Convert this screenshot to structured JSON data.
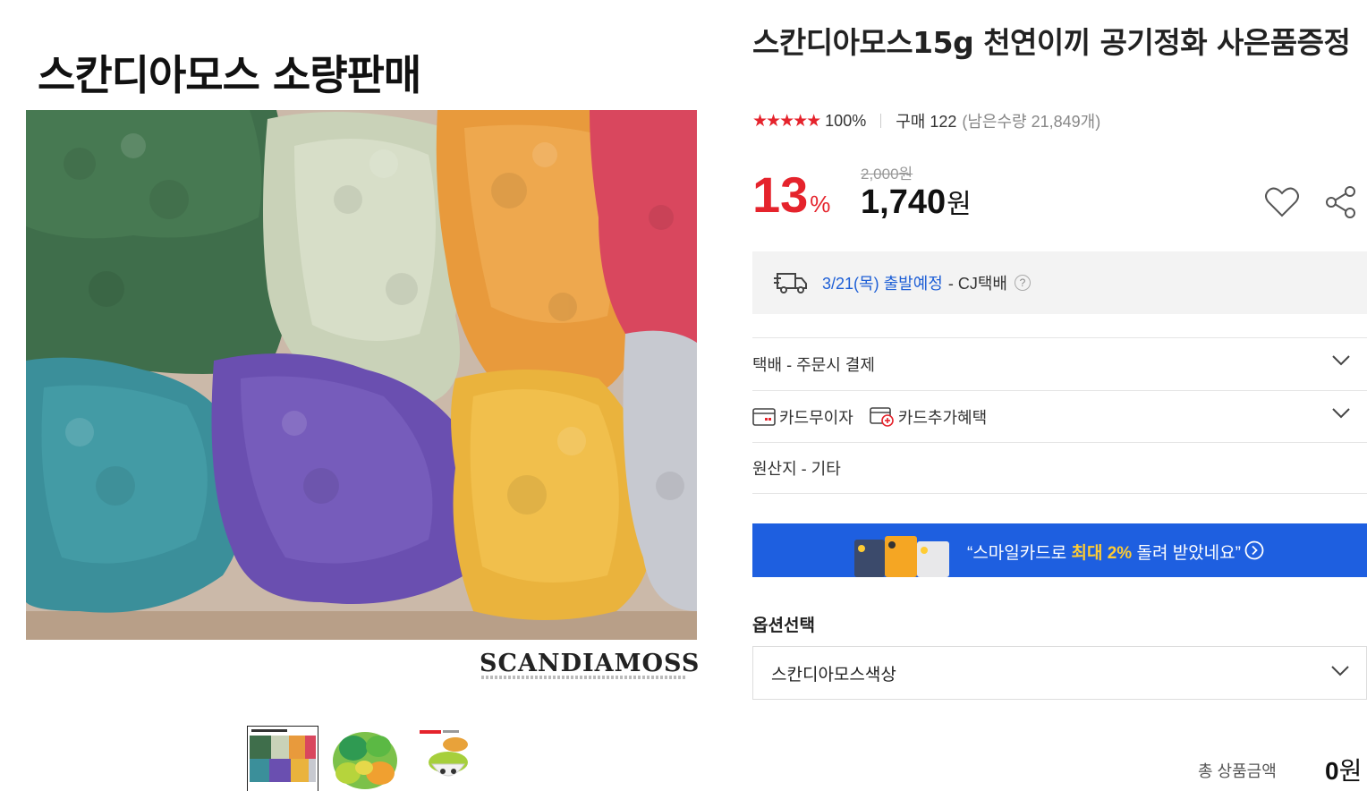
{
  "image": {
    "title": "스칸디아모스 소량판매",
    "brand": "SCANDIAMOSS"
  },
  "thumbnails": [
    {
      "name": "thumb-1",
      "caption": "스칸디아모스 소량판매"
    },
    {
      "name": "thumb-2",
      "caption": ""
    },
    {
      "name": "thumb-3",
      "caption": "15g 40g"
    }
  ],
  "product": {
    "title": "스칸디아모스15g 천연이끼 공기정화 사은품증정",
    "stars": "★★★★★",
    "rating": "100%",
    "purchases": "구매 122",
    "remaining": "(남은수량 21,849개)",
    "original_price": "2,000원",
    "discount": "13",
    "discount_unit": "%",
    "price": "1,740",
    "price_unit": "원"
  },
  "shipping": {
    "date": "3/21(목) 출발예정",
    "carrier": "- CJ택배",
    "help": "?"
  },
  "rows": {
    "delivery": "택배 - 주문시 결제",
    "card_interest": "카드무이자",
    "card_benefit": "카드추가혜택",
    "origin": "원산지 - 기타"
  },
  "promo": {
    "pre": "“스마일카드로 ",
    "highlight": "최대 2%",
    "post": " 돌려 받았네요”"
  },
  "options": {
    "label": "옵션선택",
    "selected": "스칸디아모스색상"
  },
  "total": {
    "label": "총 상품금액",
    "value": "0",
    "unit": "원"
  },
  "colors": {
    "accent_red": "#e5232c",
    "link_blue": "#1e5fd6",
    "promo_blue": "#1e5fe0",
    "promo_highlight": "#ffcc33"
  },
  "icons": [
    "heart-icon",
    "share-icon",
    "truck-icon",
    "help-icon",
    "chevron-down-icon",
    "card-icon",
    "card-plus-icon",
    "arrow-circle-icon"
  ]
}
